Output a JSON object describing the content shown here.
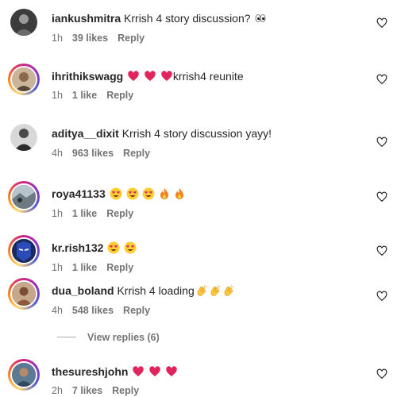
{
  "comments": [
    {
      "username": "iankushmitra",
      "text": "Krrish 4 story discussion?",
      "emojis": [
        "eyes"
      ],
      "time": "1h",
      "likes": "39 likes",
      "reply": "Reply"
    },
    {
      "username": "ihrithikswagg",
      "text_prefix": "",
      "emojis": [
        "red-heart",
        "red-heart",
        "red-heart"
      ],
      "text": "krrish4 reunite",
      "time": "1h",
      "likes": "1 like",
      "reply": "Reply"
    },
    {
      "username": "aditya__dixit",
      "text": "Krrish 4 story discussion yayy!",
      "emojis": [],
      "time": "4h",
      "likes": "963 likes",
      "reply": "Reply"
    },
    {
      "username": "roya41133",
      "text": "",
      "emojis": [
        "heart-eyes",
        "heart-eyes",
        "heart-eyes",
        "fire",
        "fire"
      ],
      "time": "1h",
      "likes": "1 like",
      "reply": "Reply"
    },
    {
      "username": "kr.rish132",
      "text": "",
      "emojis": [
        "heart-eyes",
        "heart-eyes"
      ],
      "time": "1h",
      "likes": "1 like",
      "reply": "Reply"
    },
    {
      "username": "dua_boland",
      "text": "Krrish 4 loading",
      "emojis": [
        "clapping-hands",
        "clapping-hands",
        "clapping-hands"
      ],
      "time": "4h",
      "likes": "548 likes",
      "reply": "Reply",
      "view_replies": "View replies (6)"
    },
    {
      "username": "thesureshjohn",
      "text": "",
      "emojis": [
        "red-heart",
        "red-heart",
        "red-heart"
      ],
      "time": "2h",
      "likes": "7 likes",
      "reply": "Reply"
    }
  ],
  "colors": {
    "primary_text": "#262626",
    "secondary_text": "#737373",
    "heart_emoji": "#e0245e",
    "story_ring": "#d62976"
  }
}
